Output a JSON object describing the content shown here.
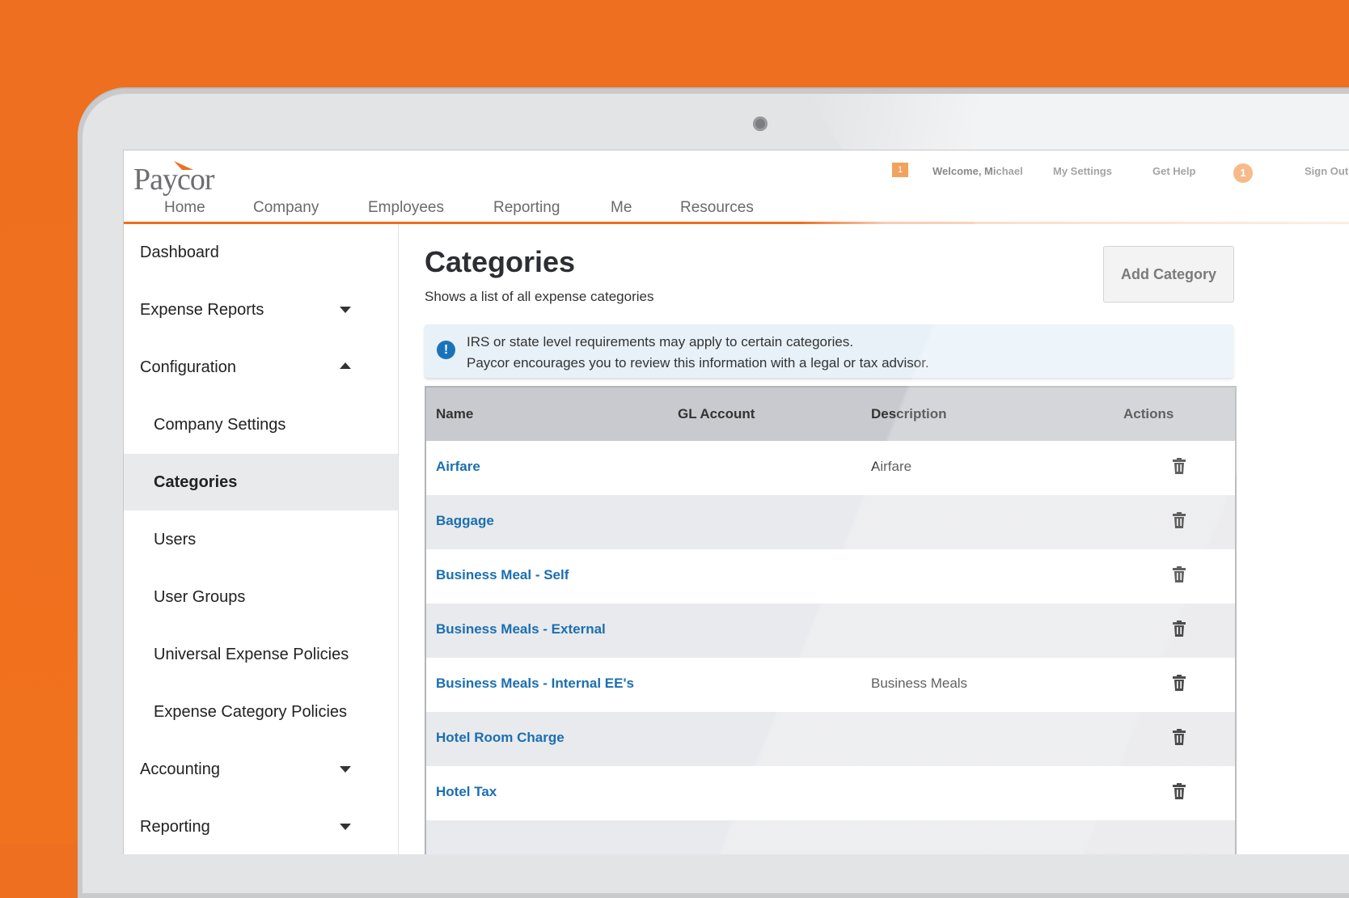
{
  "brand": {
    "logo_text": "Paycor"
  },
  "utility": {
    "notifications_count": "1",
    "welcome": "Welcome, Michael",
    "my_settings": "My Settings",
    "get_help": "Get Help",
    "help_count": "1",
    "sign_out": "Sign Out"
  },
  "nav": {
    "items": [
      "Home",
      "Company",
      "Employees",
      "Reporting",
      "Me",
      "Resources"
    ]
  },
  "sidebar": {
    "items": [
      {
        "label": "Dashboard"
      },
      {
        "label": "Expense Reports"
      },
      {
        "label": "Configuration"
      },
      {
        "label": "Company Settings"
      },
      {
        "label": "Categories"
      },
      {
        "label": "Users"
      },
      {
        "label": "User Groups"
      },
      {
        "label": "Universal Expense Policies"
      },
      {
        "label": "Expense Category Policies"
      },
      {
        "label": "Accounting"
      },
      {
        "label": "Reporting"
      }
    ]
  },
  "page": {
    "title": "Categories",
    "subtitle": "Shows a list of all expense categories",
    "add_button": "Add Category"
  },
  "alert": {
    "line1": "IRS or state level requirements may apply to certain categories.",
    "line2": "Paycor encourages you to review this information with a legal or tax advisor."
  },
  "table": {
    "columns": [
      "Name",
      "GL Account",
      "Description",
      "Actions"
    ],
    "rows": [
      {
        "name": "Airfare",
        "gl_account": "",
        "description": "Airfare"
      },
      {
        "name": "Baggage",
        "gl_account": "",
        "description": ""
      },
      {
        "name": "Business Meal - Self",
        "gl_account": "",
        "description": ""
      },
      {
        "name": "Business Meals - External",
        "gl_account": "",
        "description": ""
      },
      {
        "name": "Business Meals - Internal EE's",
        "gl_account": "",
        "description": "Business Meals"
      },
      {
        "name": "Hotel Room Charge",
        "gl_account": "",
        "description": ""
      },
      {
        "name": "Hotel Tax",
        "gl_account": "",
        "description": ""
      }
    ]
  },
  "colors": {
    "brand_orange": "#ee6f1f",
    "link_blue": "#1a6fb0",
    "info_blue": "#1a73b9"
  }
}
